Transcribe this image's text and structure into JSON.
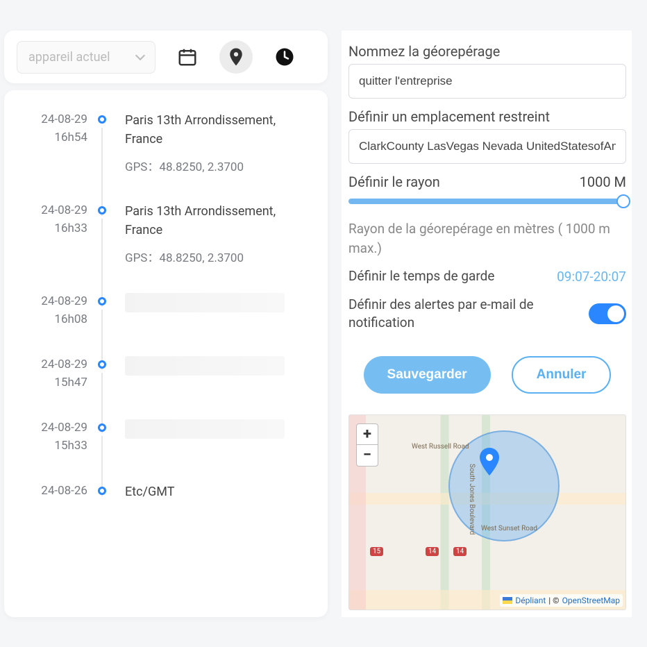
{
  "toolbar": {
    "device_selector_placeholder": "appareil actuel"
  },
  "timeline": [
    {
      "date": "24-08-29",
      "time": "16h54",
      "location": "Paris 13th Arrondissement, France",
      "gps_label": "GPS：",
      "gps_value": "48.8250, 2.3700",
      "redacted": false
    },
    {
      "date": "24-08-29",
      "time": "16h33",
      "location": "Paris 13th Arrondissement, France",
      "gps_label": "GPS：",
      "gps_value": "48.8250, 2.3700",
      "redacted": false
    },
    {
      "date": "24-08-29",
      "time": "16h08",
      "location": "",
      "gps_label": "",
      "gps_value": "",
      "redacted": true
    },
    {
      "date": "24-08-29",
      "time": "15h47",
      "location": "",
      "gps_label": "",
      "gps_value": "",
      "redacted": true
    },
    {
      "date": "24-08-29",
      "time": "15h33",
      "location": "",
      "gps_label": "",
      "gps_value": "",
      "redacted": true
    },
    {
      "date": "24-08-26",
      "time": "",
      "location": "Etc/GMT",
      "gps_label": "",
      "gps_value": "",
      "redacted": false
    }
  ],
  "form": {
    "name_label": "Nommez la géorepérage",
    "name_value": "quitter l'entreprise",
    "location_label": "Définir un emplacement restreint",
    "location_value": "ClarkCounty LasVegas Nevada UnitedStatesofAmerica(tl",
    "radius_label": "Définir le rayon",
    "radius_value": "1000 M",
    "radius_hint": "Rayon de la géorepérage en mètres ( 1000 m max.)",
    "guard_label": "Définir le temps de garde",
    "guard_time": "09:07-20:07",
    "alert_label": "Définir des alertes par e-mail de notification",
    "alert_enabled": true,
    "save_btn": "Sauvegarder",
    "cancel_btn": "Annuler"
  },
  "map": {
    "zoom_in": "+",
    "zoom_out": "−",
    "road_labels": [
      "West Russell Road",
      "West Sunset Road",
      "South Jones Boulevard"
    ],
    "shields": [
      "15",
      "14",
      "14"
    ],
    "attrib_link1": "Dépliant",
    "attrib_sep": " | © ",
    "attrib_link2": "OpenStreetMap"
  }
}
